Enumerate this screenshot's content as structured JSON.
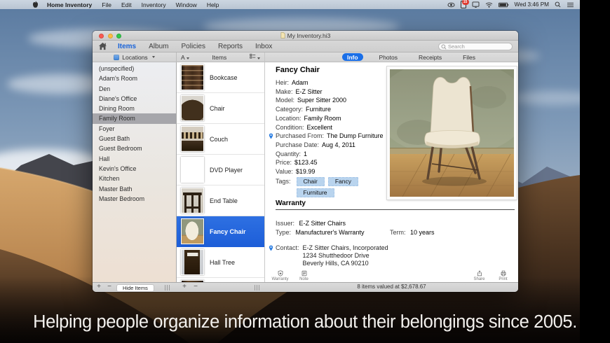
{
  "menu_bar": {
    "app_items": [
      "Home Inventory",
      "File",
      "Edit",
      "Inventory",
      "Window",
      "Help"
    ],
    "badge_count": "15",
    "clock": "Wed 3:46 PM"
  },
  "window": {
    "title": "My Inventory.hi3",
    "toolbar": {
      "tabs": [
        "Items",
        "Album",
        "Policies",
        "Reports",
        "Inbox"
      ],
      "active_tab": "Items",
      "search_placeholder": "Search"
    },
    "columns": {
      "locations_header": "Locations",
      "sort_label": "A",
      "items_header": "Items"
    },
    "detail_tabs": [
      "Info",
      "Photos",
      "Receipts",
      "Files"
    ],
    "active_detail_tab": "Info",
    "locations": [
      "(unspecified)",
      "Adam's Room",
      "Den",
      "Diane's Office",
      "Dining Room",
      "Family Room",
      "Foyer",
      "Guest Bath",
      "Guest Bedroom",
      "Hall",
      "Kevin's Office",
      "Kitchen",
      "Master Bath",
      "Master Bedroom"
    ],
    "selected_location": "Family Room",
    "items": [
      "Bookcase",
      "Chair",
      "Couch",
      "DVD Player",
      "End Table",
      "Fancy Chair",
      "Hall Tree"
    ],
    "selected_item": "Fancy Chair",
    "detail": {
      "title": "Fancy Chair",
      "fields": [
        {
          "label": "Heir:",
          "value": "Adam"
        },
        {
          "label": "Make:",
          "value": "E-Z Sitter"
        },
        {
          "label": "Model:",
          "value": "Super Sitter 2000"
        },
        {
          "label": "Category:",
          "value": "Furniture"
        },
        {
          "label": "Location:",
          "value": "Family Room"
        },
        {
          "label": "Condition:",
          "value": "Excellent"
        },
        {
          "label": "Purchased From:",
          "value": "The Dump Furniture",
          "pin": true
        },
        {
          "label": "Purchase Date:",
          "value": "Aug 4, 2011"
        },
        {
          "label": "Quantity:",
          "value": "1"
        },
        {
          "label": "Price:",
          "value": "$123.45"
        },
        {
          "label": "Value:",
          "value": "$19.99"
        }
      ],
      "tags_label": "Tags:",
      "tags": [
        "Chair",
        "Fancy",
        "Furniture"
      ],
      "warranty": {
        "heading": "Warranty",
        "issuer_label": "Issuer:",
        "issuer": "E-Z Sitter Chairs",
        "type_label": "Type:",
        "type": "Manufacturer's Warranty",
        "term_label": "Term:",
        "term": "10 years",
        "contact_label": "Contact:",
        "contact_lines": [
          "E-Z Sitter Chairs, Incorporated",
          "1234 Shutthedoor Drive",
          "Beverly Hills, CA 90210"
        ]
      }
    },
    "action_bar": {
      "left": [
        "Warranty",
        "Note"
      ],
      "right": [
        "Share",
        "Print"
      ]
    },
    "status_bar": {
      "hide_items_label": "Hide Items",
      "summary": "8 items valued at $2,678.67"
    }
  },
  "caption": "Helping people organize information about their belongings since 2005.",
  "colors": {
    "accent_blue": "#1a64d9",
    "selection_blue": "#1d5ed8",
    "info_pill_blue": "#1a6fe8",
    "tag_bg": "#b9d4ee",
    "menubar_bg": "#c4cfdb",
    "badge_red": "#e03b30"
  }
}
